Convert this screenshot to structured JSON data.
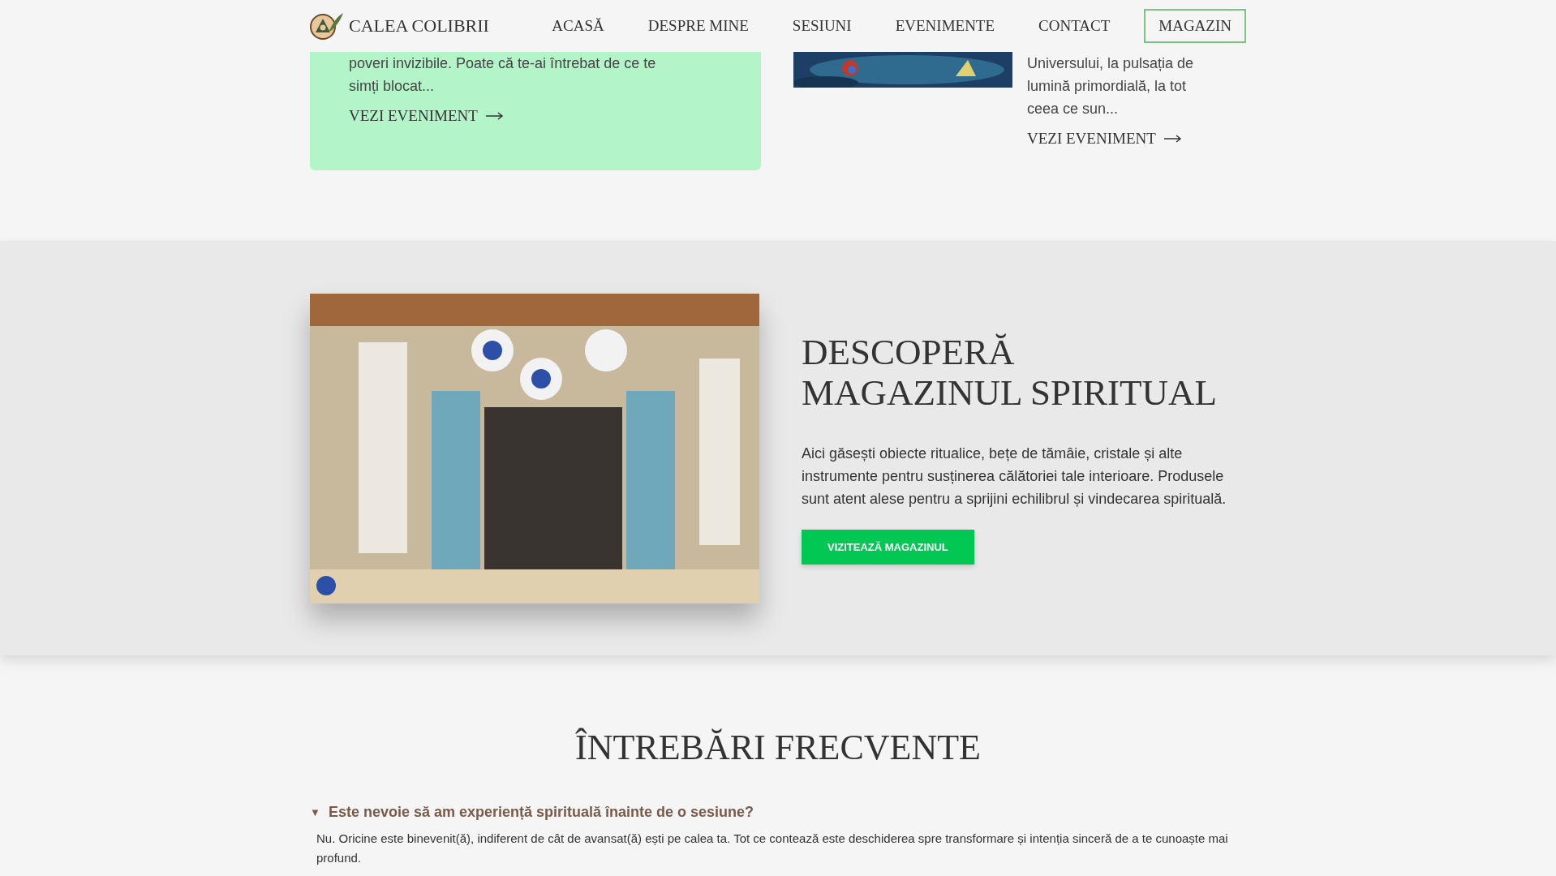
{
  "header": {
    "logo_text": "CALEA COLIBRII",
    "nav": [
      {
        "label": "ACASĂ",
        "selected": false
      },
      {
        "label": "DESPRE MINE",
        "selected": false
      },
      {
        "label": "SESIUNI",
        "selected": false
      },
      {
        "label": "EVENIMENTE",
        "selected": false
      },
      {
        "label": "CONTACT",
        "selected": false
      },
      {
        "label": "MAGAZIN",
        "selected": true
      }
    ]
  },
  "events": [
    {
      "lines": [
        "poveri invizibile. Poate că te-ai întrebat de ce te",
        "simți blocat..."
      ],
      "link": "VEZI EVENIMENT",
      "highlighted": true,
      "has_image": false
    },
    {
      "lines": [
        "Universului, la pulsația de",
        "lumină primordială, la tot",
        "ceea ce sun..."
      ],
      "link": "VEZI EVENIMENT",
      "highlighted": false,
      "has_image": true
    }
  ],
  "shop": {
    "title": "DESCOPERĂ MAGAZINUL SPIRITUAL",
    "text": "Aici găsești obiecte ritualice, bețe de tămâie, cristale și alte instrumente pentru susținerea călătoriei tale interioare. Produsele sunt atent alese pentru a sprijini echilibrul și vindecarea spirituală.",
    "button": "VIZITEAZĂ MAGAZINUL"
  },
  "faq": {
    "title": "ÎNTREBĂRI FRECVENTE",
    "items": [
      {
        "toggle": "▼",
        "question": "Este nevoie să am experiență spirituală înainte de o sesiune?",
        "answer": "Nu. Oricine este binevenit(ă), indiferent de cât de avansat(ă) ești pe calea ta. Tot ce contează este deschiderea spre transformare și intenția sinceră de a te cunoaște mai profund.",
        "expanded": true
      }
    ]
  }
}
